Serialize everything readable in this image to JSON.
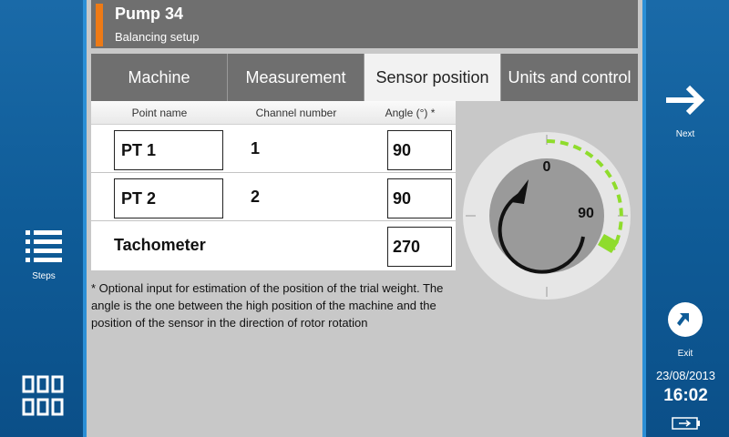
{
  "header": {
    "title": "Pump 34",
    "subtitle": "Balancing setup",
    "accent_color": "#ee7a16"
  },
  "tabs": [
    {
      "label": "Machine"
    },
    {
      "label": "Measurement"
    },
    {
      "label": "Sensor position",
      "active": true
    },
    {
      "label": "Units and control"
    }
  ],
  "table": {
    "headers": [
      "Point name",
      "Channel number",
      "Angle (°) *"
    ],
    "rows": [
      {
        "name": "PT 1",
        "channel": "1",
        "angle": "90"
      },
      {
        "name": "PT 2",
        "channel": "2",
        "angle": "90"
      }
    ],
    "tachometer": {
      "label": "Tachometer",
      "angle": "270"
    }
  },
  "note": "* Optional input for estimation of the position of the trial weight. The angle is the one between the high position of the machine and the position of the sensor in the direction of rotor rotation",
  "dial": {
    "label_top": "0",
    "label_right": "90",
    "indicator_color": "#8fdc2c"
  },
  "left_sidebar": {
    "steps_label": "Steps",
    "steps_icon": "list-icon",
    "apps_icon": "grid-icon"
  },
  "right_sidebar": {
    "next_label": "Next",
    "next_icon": "arrow-right-icon",
    "exit_label": "Exit",
    "exit_icon": "exit-icon",
    "date": "23/08/2013",
    "time": "16:02",
    "battery_icon": "battery-charging-icon"
  }
}
